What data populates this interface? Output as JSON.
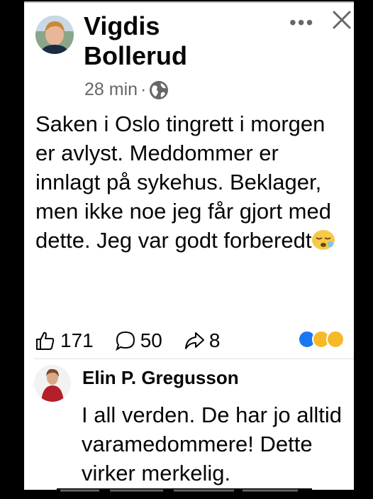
{
  "post": {
    "author": "Vigdis Bollerud",
    "time": "28 min",
    "separator": "·",
    "privacy_icon": "globe-icon",
    "more_label": "•••",
    "close_label": "✕",
    "text": "Saken i Oslo tingrett i morgen er avlyst. Meddommer er innlagt på sykehus. Beklager, men ikke noe jeg får gjort med dette. Jeg var godt forberedt",
    "emoji": "sleepy-face-emoji"
  },
  "stats": {
    "likes": "171",
    "comments": "50",
    "shares": "8",
    "reactions": [
      "like",
      "wow",
      "sad"
    ]
  },
  "comment": {
    "author": "Elin P. Gregusson",
    "text": "I all verden. De har jo alltid varamedommere! Dette virker merkelig."
  },
  "colors": {
    "background": "#000000",
    "card": "#ffffff",
    "text": "#050505",
    "secondary": "#65676b",
    "like_blue": "#1877f2",
    "wow_yellow": "#f7b928"
  }
}
